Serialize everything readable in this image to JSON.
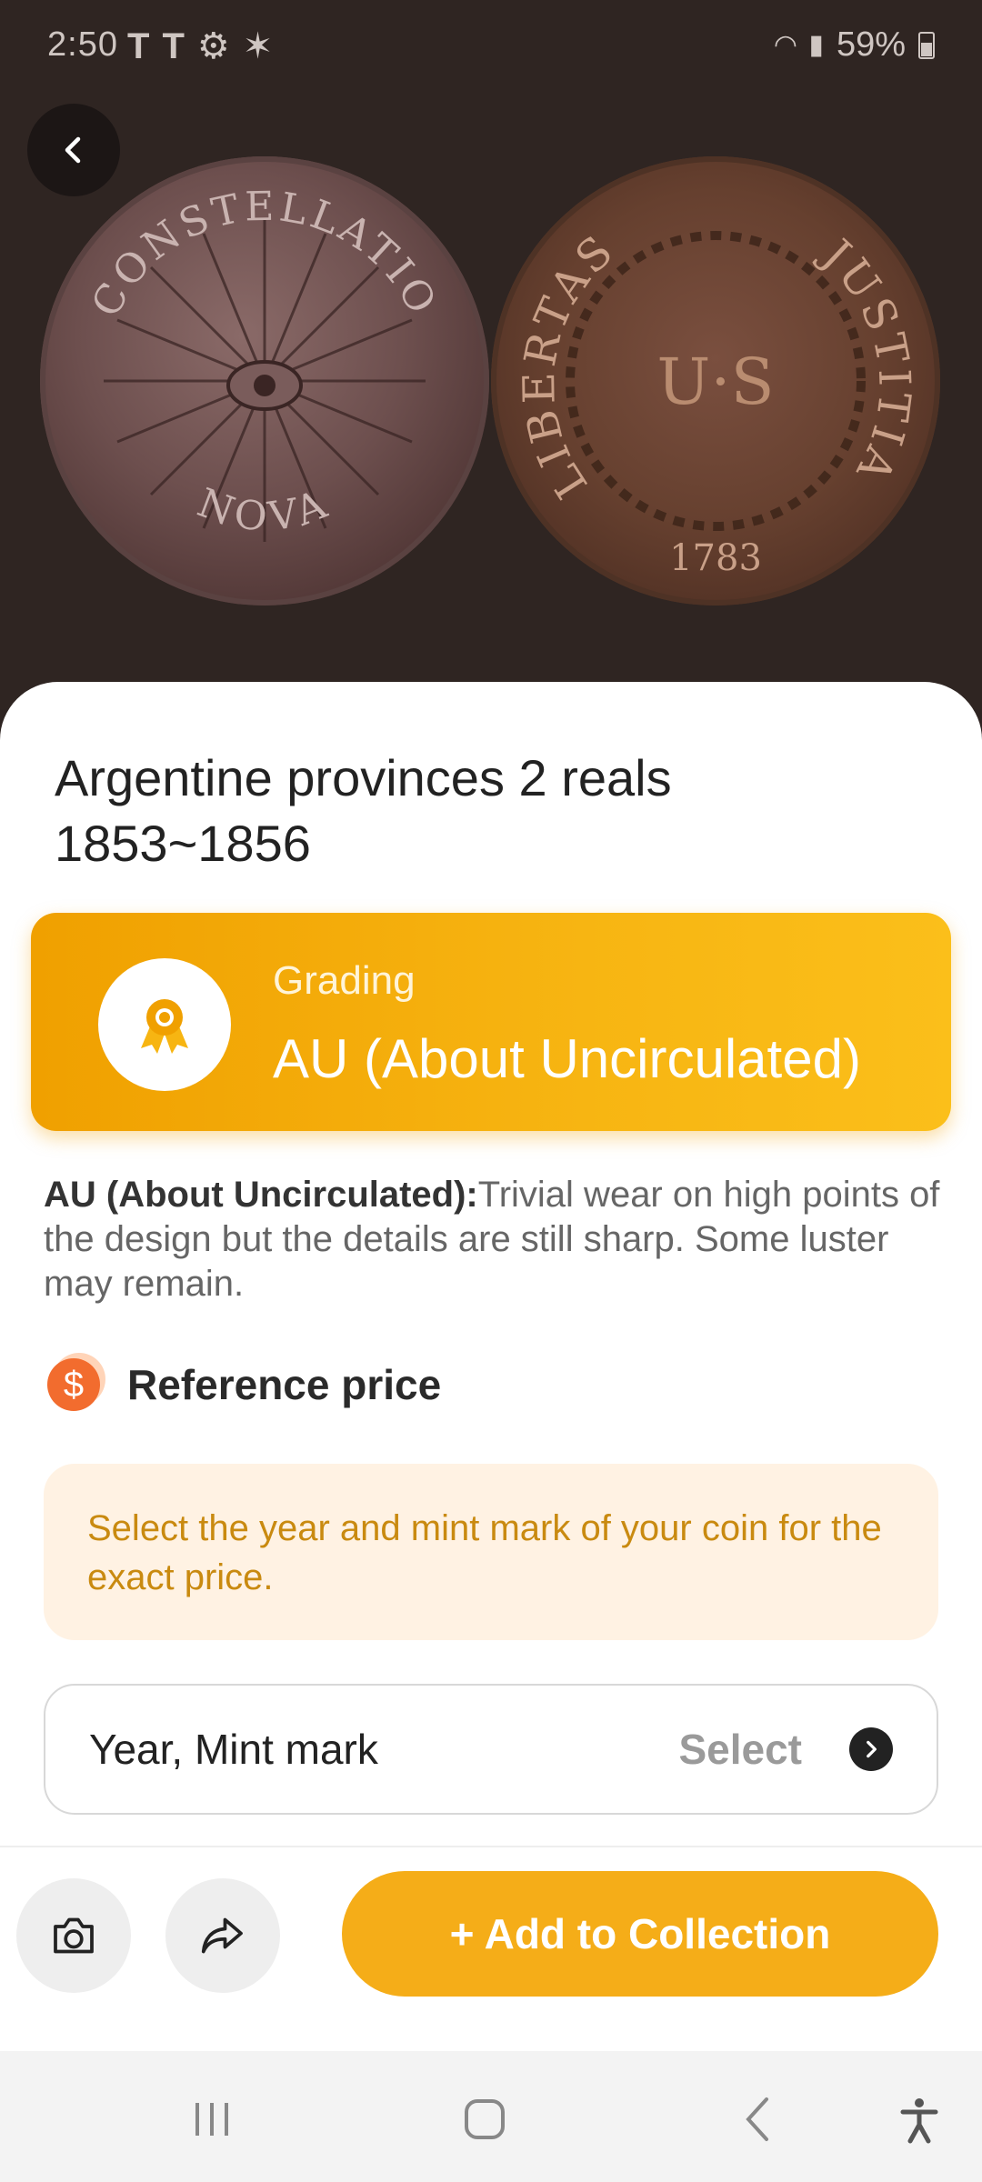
{
  "status_bar": {
    "time": "2:50",
    "battery": "59%"
  },
  "coin_images": {
    "obverse_text_top": "CONSTELLATIO",
    "obverse_text_bottom": "NOVA",
    "reverse_text_left": "LIBERTAS",
    "reverse_text_right": "JUSTITIA",
    "reverse_center": "U·S",
    "reverse_year": "1783"
  },
  "coin": {
    "title": "Argentine provinces 2 reals 1853~1856"
  },
  "grading": {
    "label": "Grading",
    "value": "AU (About Uncirculated)"
  },
  "description": {
    "term": "AU (About Uncirculated):",
    "text": "Trivial wear on high points of the design but the details are still sharp. Some luster may remain."
  },
  "reference_price": {
    "title": "Reference price",
    "notice": "Select the year and mint mark of your coin for the exact price."
  },
  "selector": {
    "label": "Year, Mint mark",
    "action": "Select"
  },
  "actions": {
    "add_label": "+ Add to Collection"
  },
  "colors": {
    "accent": "#f5ad18",
    "accent_dark": "#f0a000",
    "notice_bg": "#fff2e3",
    "notice_text": "#c98a10"
  }
}
